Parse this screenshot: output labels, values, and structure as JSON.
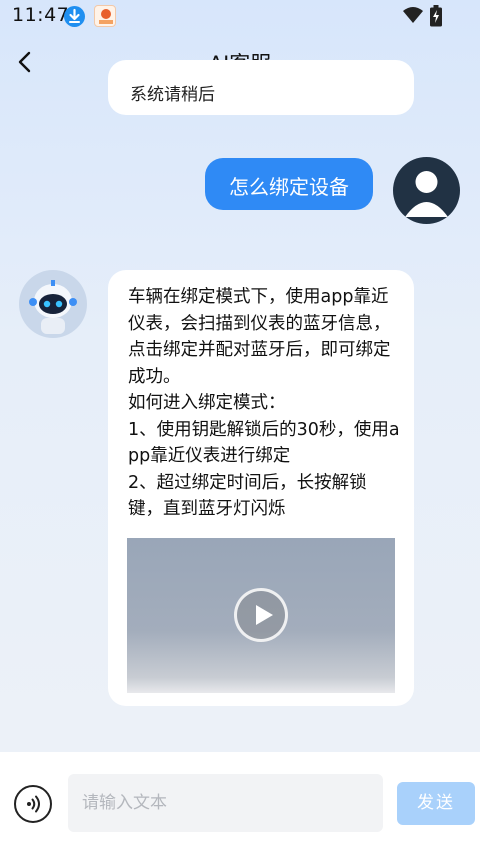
{
  "status_bar": {
    "time": "11:47",
    "icons": [
      "download-icon",
      "app-notification-icon",
      "wifi-icon",
      "battery-charging-icon"
    ]
  },
  "header": {
    "title": "AI客服",
    "back_icon": "chevron-left-icon"
  },
  "messages": {
    "previous_bot_partial": "系统请稍后",
    "user_message": "怎么绑定设备",
    "bot_reply_lines": [
      "车辆在绑定模式下，使用app靠近仪表，会扫描到仪表的蓝牙信息，点击绑定并配对蓝牙后，即可绑定成功。",
      "如何进入绑定模式：",
      "1、使用钥匙解锁后的30秒，使用app靠近仪表进行绑定",
      "2、超过绑定时间后，长按解锁键，直到蓝牙灯闪烁"
    ],
    "video_play_icon": "play-icon"
  },
  "input_bar": {
    "placeholder": "请输入文本",
    "value": "",
    "send_label": "发送",
    "voice_icon": "voice-icon"
  },
  "colors": {
    "user_bubble": "#2f8af5",
    "send_button": "#a9d1fb",
    "background_top": "#d7e6fb"
  }
}
